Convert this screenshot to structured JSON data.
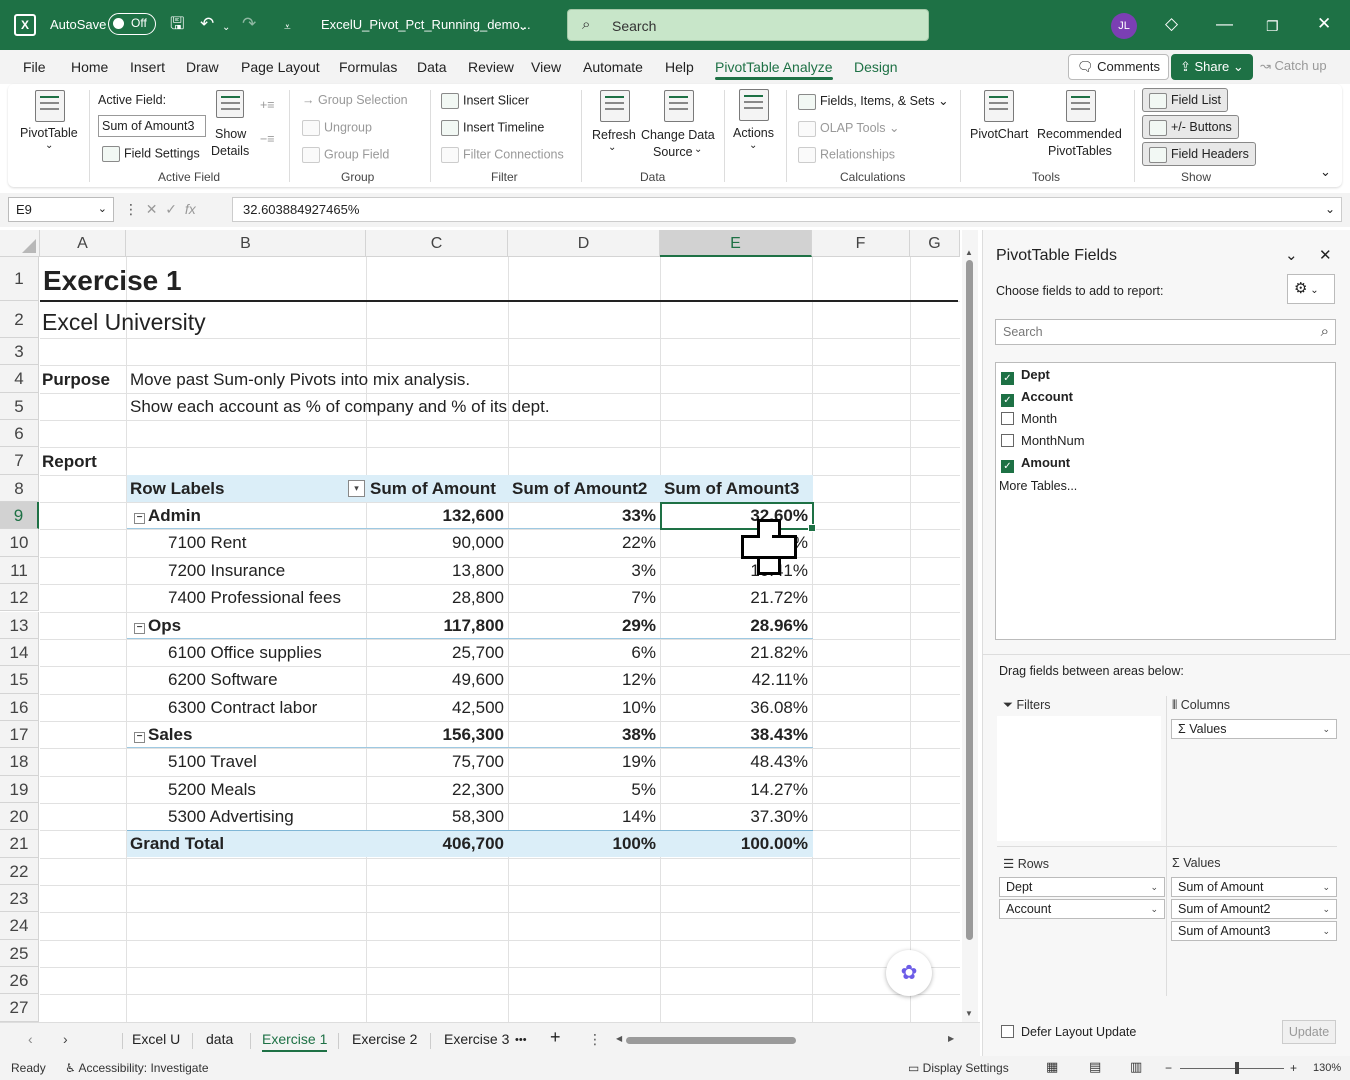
{
  "titlebar": {
    "autosave_label": "AutoSave",
    "autosave_state": "Off",
    "file_name": "ExcelU_Pivot_Pct_Running_demo...",
    "search_placeholder": "Search",
    "user_initials": "JL"
  },
  "menu": {
    "tabs": [
      "File",
      "Home",
      "Insert",
      "Draw",
      "Page Layout",
      "Formulas",
      "Data",
      "Review",
      "View",
      "Automate",
      "Help",
      "PivotTable Analyze",
      "Design"
    ],
    "active_tab": "PivotTable Analyze",
    "comments_label": "Comments",
    "share_label": "Share",
    "catchup_label": "Catch up"
  },
  "ribbon": {
    "pivottable": "PivotTable",
    "active_field_label": "Active Field:",
    "active_field_value": "Sum of Amount3",
    "field_settings": "Field Settings",
    "show_details_1": "Show",
    "show_details_2": "Details",
    "group_active_field": "Active Field",
    "group_selection": "Group Selection",
    "ungroup": "Ungroup",
    "group_field": "Group Field",
    "group_group": "Group",
    "insert_slicer": "Insert Slicer",
    "insert_timeline": "Insert Timeline",
    "filter_connections": "Filter Connections",
    "group_filter": "Filter",
    "refresh": "Refresh",
    "change_data_source_1": "Change Data",
    "change_data_source_2": "Source",
    "group_data": "Data",
    "actions": "Actions",
    "fields_items_sets": "Fields, Items, & Sets",
    "olap_tools": "OLAP Tools",
    "relationships": "Relationships",
    "group_calculations": "Calculations",
    "pivotchart": "PivotChart",
    "recommended_1": "Recommended",
    "recommended_2": "PivotTables",
    "group_tools": "Tools",
    "field_list": "Field List",
    "buttons": "+/- Buttons",
    "field_headers": "Field Headers",
    "group_show": "Show"
  },
  "formula_bar": {
    "name_box": "E9",
    "formula": "32.603884927465%"
  },
  "grid": {
    "columns": [
      "A",
      "B",
      "C",
      "D",
      "E",
      "F",
      "G"
    ],
    "selected_column": "E",
    "rows": [
      "1",
      "2",
      "3",
      "4",
      "5",
      "6",
      "7",
      "8",
      "9",
      "10",
      "11",
      "12",
      "13",
      "14",
      "15",
      "16",
      "17",
      "18",
      "19",
      "20",
      "21",
      "22",
      "23",
      "24",
      "25",
      "26",
      "27"
    ],
    "selected_row": "9",
    "title": "Exercise 1",
    "subtitle": "Excel University",
    "purpose_label": "Purpose",
    "purpose_line1": "Move past Sum-only Pivots into mix analysis.",
    "purpose_line2": "Show each account as % of company and % of its dept.",
    "report_label": "Report"
  },
  "pivot": {
    "headers": [
      "Row Labels",
      "Sum of Amount",
      "Sum of Amount2",
      "Sum of Amount3"
    ],
    "rows": [
      {
        "label": "Admin",
        "amount": "132,600",
        "pct": "33%",
        "pct_dept": "32.60%",
        "level": "dept"
      },
      {
        "label": "7100 Rent",
        "amount": "90,000",
        "pct": "22%",
        "pct_dept": "%",
        "level": "acct"
      },
      {
        "label": "7200 Insurance",
        "amount": "13,800",
        "pct": "3%",
        "pct_dept": "10.41%",
        "level": "acct"
      },
      {
        "label": "7400 Professional fees",
        "amount": "28,800",
        "pct": "7%",
        "pct_dept": "21.72%",
        "level": "acct"
      },
      {
        "label": "Ops",
        "amount": "117,800",
        "pct": "29%",
        "pct_dept": "28.96%",
        "level": "dept"
      },
      {
        "label": "6100 Office supplies",
        "amount": "25,700",
        "pct": "6%",
        "pct_dept": "21.82%",
        "level": "acct"
      },
      {
        "label": "6200 Software",
        "amount": "49,600",
        "pct": "12%",
        "pct_dept": "42.11%",
        "level": "acct"
      },
      {
        "label": "6300 Contract labor",
        "amount": "42,500",
        "pct": "10%",
        "pct_dept": "36.08%",
        "level": "acct"
      },
      {
        "label": "Sales",
        "amount": "156,300",
        "pct": "38%",
        "pct_dept": "38.43%",
        "level": "dept"
      },
      {
        "label": "5100 Travel",
        "amount": "75,700",
        "pct": "19%",
        "pct_dept": "48.43%",
        "level": "acct"
      },
      {
        "label": "5200 Meals",
        "amount": "22,300",
        "pct": "5%",
        "pct_dept": "14.27%",
        "level": "acct"
      },
      {
        "label": "5300 Advertising",
        "amount": "58,300",
        "pct": "14%",
        "pct_dept": "37.30%",
        "level": "acct"
      }
    ],
    "grand_total": {
      "label": "Grand Total",
      "amount": "406,700",
      "pct": "100%",
      "pct_dept": "100.00%"
    }
  },
  "sheet_tabs": {
    "tabs": [
      "Excel U",
      "data",
      "Exercise 1",
      "Exercise 2",
      "Exercise 3"
    ],
    "active": "Exercise 1",
    "more": "•••",
    "add": "+"
  },
  "status": {
    "ready": "Ready",
    "accessibility": "Accessibility: Investigate",
    "display_settings": "Display Settings",
    "zoom": "130%"
  },
  "pane": {
    "title": "PivotTable Fields",
    "choose_fields": "Choose fields to add to report:",
    "search_placeholder": "Search",
    "fields": [
      {
        "name": "Dept",
        "checked": true
      },
      {
        "name": "Account",
        "checked": true
      },
      {
        "name": "Month",
        "checked": false
      },
      {
        "name": "MonthNum",
        "checked": false
      },
      {
        "name": "Amount",
        "checked": true
      }
    ],
    "more_tables": "More Tables...",
    "drag_fields": "Drag fields between areas below:",
    "filters_label": "Filters",
    "columns_label": "Columns",
    "columns_items": [
      "Values"
    ],
    "rows_label": "Rows",
    "rows_items": [
      "Dept",
      "Account"
    ],
    "values_label": "Values",
    "values_items": [
      "Sum of Amount",
      "Sum of Amount2",
      "Sum of Amount3"
    ],
    "defer_label": "Defer Layout Update",
    "update_label": "Update"
  },
  "colors": {
    "accent": "#1e7145",
    "pivot_header": "#dbeef8"
  }
}
